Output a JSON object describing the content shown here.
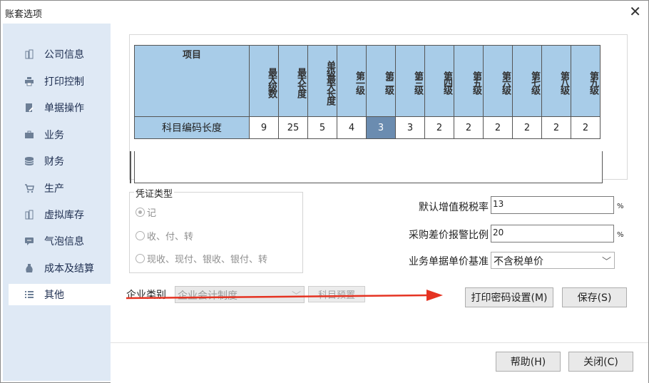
{
  "window": {
    "title": "账套选项",
    "close_glyph": "✕"
  },
  "sidebar": {
    "items": [
      {
        "label": "公司信息",
        "icon": "building-icon"
      },
      {
        "label": "打印控制",
        "icon": "printer-icon"
      },
      {
        "label": "单据操作",
        "icon": "document-edit-icon"
      },
      {
        "label": "业务",
        "icon": "briefcase-icon"
      },
      {
        "label": "财务",
        "icon": "database-icon"
      },
      {
        "label": "生产",
        "icon": "cart-icon"
      },
      {
        "label": "虚拟库存",
        "icon": "building-icon"
      },
      {
        "label": "气泡信息",
        "icon": "chat-bubble-icon"
      },
      {
        "label": "成本及结算",
        "icon": "money-bag-icon"
      },
      {
        "label": "其他",
        "icon": "list-icon"
      }
    ],
    "active_index": 9
  },
  "code_table": {
    "headers": [
      "项目",
      "最大级数",
      "最大长度",
      "单级最大长度",
      "第一级",
      "第二级",
      "第三级",
      "第四级",
      "第五级",
      "第六级",
      "第七级",
      "第八级",
      "第九级"
    ],
    "row_label": "科目编码长度",
    "values": [
      "9",
      "25",
      "5",
      "4",
      "3",
      "3",
      "2",
      "2",
      "2",
      "2",
      "2",
      "2"
    ],
    "selected_index": 4
  },
  "voucher_type": {
    "title": "凭证类型",
    "options": [
      "记",
      "收、付、转",
      "现收、现付、银收、银付、转"
    ],
    "selected_index": 0
  },
  "vat": {
    "label": "默认增值税税率",
    "value": "13",
    "unit": "%"
  },
  "variance": {
    "label": "采购差价报警比例",
    "value": "20",
    "unit": "%"
  },
  "price_basis": {
    "label": "业务单据单价基准",
    "value": "不含税单价"
  },
  "enterprise": {
    "label": "企业类别",
    "value": "企业会计制度",
    "button": "科目预置"
  },
  "buttons": {
    "print_password": "打印密码设置(M)",
    "save": "保存(S)",
    "help": "帮助(H)",
    "close": "关闭(C)"
  },
  "colors": {
    "sidebar_bg": "#dfe9f5",
    "header_bg": "#a8cce8",
    "selected_cell": "#6b8cb0",
    "arrow": "#e53322"
  }
}
